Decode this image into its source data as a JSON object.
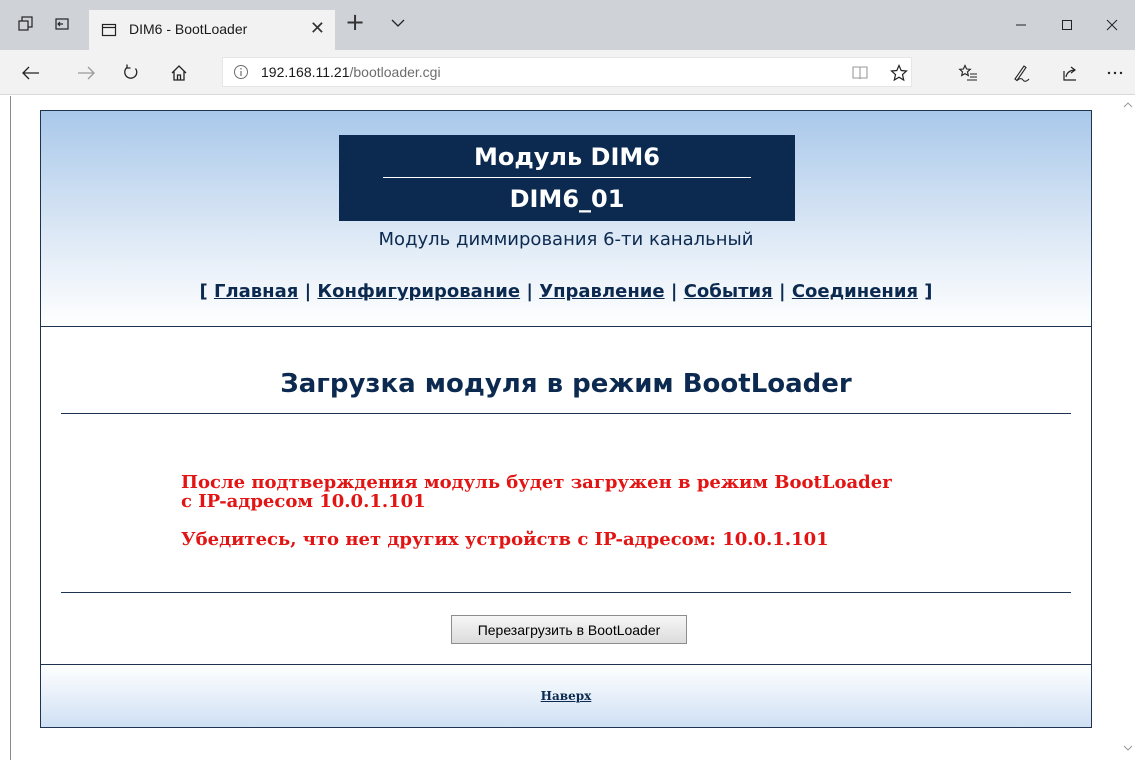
{
  "browser": {
    "tab_title": "DIM6 - BootLoader",
    "close_glyph": "✕",
    "new_tab_glyph": "+",
    "address_host": "192.168.11.21",
    "address_path": "/bootloader.cgi"
  },
  "header": {
    "module_title": "Модуль DIM6",
    "module_name": "DIM6_01",
    "subtitle": "Модуль диммирования 6-ти канальный"
  },
  "nav": {
    "open_bracket": "[ ",
    "close_bracket": " ]",
    "separator": " | ",
    "items": [
      "Главная",
      "Конфигурирование",
      "Управление",
      "События",
      "Соединения"
    ]
  },
  "main": {
    "heading": "Загрузка модуля в режим BootLoader",
    "warning_line1": "После подтверждения модуль будет загружен в режим BootLoader",
    "warning_line2": "с IP-адресом 10.0.1.101",
    "warning_line3": "Убедитесь, что нет других устройств с IP-адресом: 10.0.1.101",
    "button_label": "Перезагрузить в BootLoader"
  },
  "footer": {
    "top_link": "Наверх"
  },
  "colors": {
    "brand_navy": "#0c2a50",
    "warning_red": "#e21414"
  }
}
